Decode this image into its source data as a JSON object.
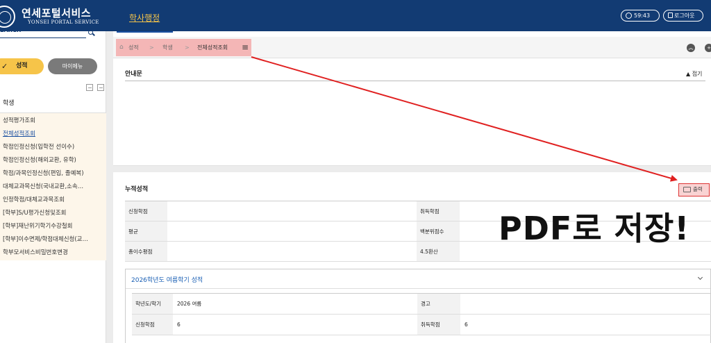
{
  "header": {
    "logo_title": "연세포털서비스",
    "logo_subtitle": "YONSEI PORTAL SERVICE",
    "main_menu": "학사행정",
    "timer": "59:43",
    "logout": "로그아웃"
  },
  "sidebar": {
    "search_placeholder": "EARCH",
    "btn_grade": "성적",
    "btn_my": "마이메뉴",
    "section": "학생",
    "items": [
      "성적평가조회",
      "전체성적조회",
      "학점인정신청(입학전 선이수)",
      "학점인정신청(해외교환, 유학)",
      "학점/과목인정신청(편입, 졸예복)",
      "대체교과목신청(국내교환,소속…",
      "인정학점/대체교과목조회",
      "[학부]S/U평가신청및조회",
      "[학부]재난위기학기수강철회",
      "[학부]이수면제/학점대체신청(교…",
      "학부모서비스비밀번호변경"
    ]
  },
  "breadcrumb": {
    "items": [
      "성적",
      "학생",
      "전체성적조회"
    ],
    "separator": ">"
  },
  "notice": {
    "title": "안내문",
    "fold": "▲ 접기"
  },
  "cumulative": {
    "title": "누적성적",
    "print": "출력",
    "rows": [
      {
        "label1": "신청학점",
        "value1": "",
        "label2": "취득학점",
        "value2": ""
      },
      {
        "label1": "평균",
        "value1": "",
        "label2": "백분위점수",
        "value2": ""
      },
      {
        "label1": "총이수평점",
        "value1": "",
        "label2": "4.5환산",
        "value2": ""
      }
    ]
  },
  "semester": {
    "title": "2026학년도 여름학기 성적",
    "rows": [
      {
        "label1": "학년도/학기",
        "value1": "2026 여름",
        "label2": "경고",
        "value2": ""
      },
      {
        "label1": "신청학점",
        "value1": "6",
        "label2": "취득학점",
        "value2": "6"
      }
    ]
  },
  "annotation": {
    "text": "PDF로 저장!",
    "color": "#e02020"
  },
  "colors": {
    "header_bg": "#123b73",
    "accent_yellow": "#f6c449",
    "highlight_red": "#f4b6b6"
  }
}
